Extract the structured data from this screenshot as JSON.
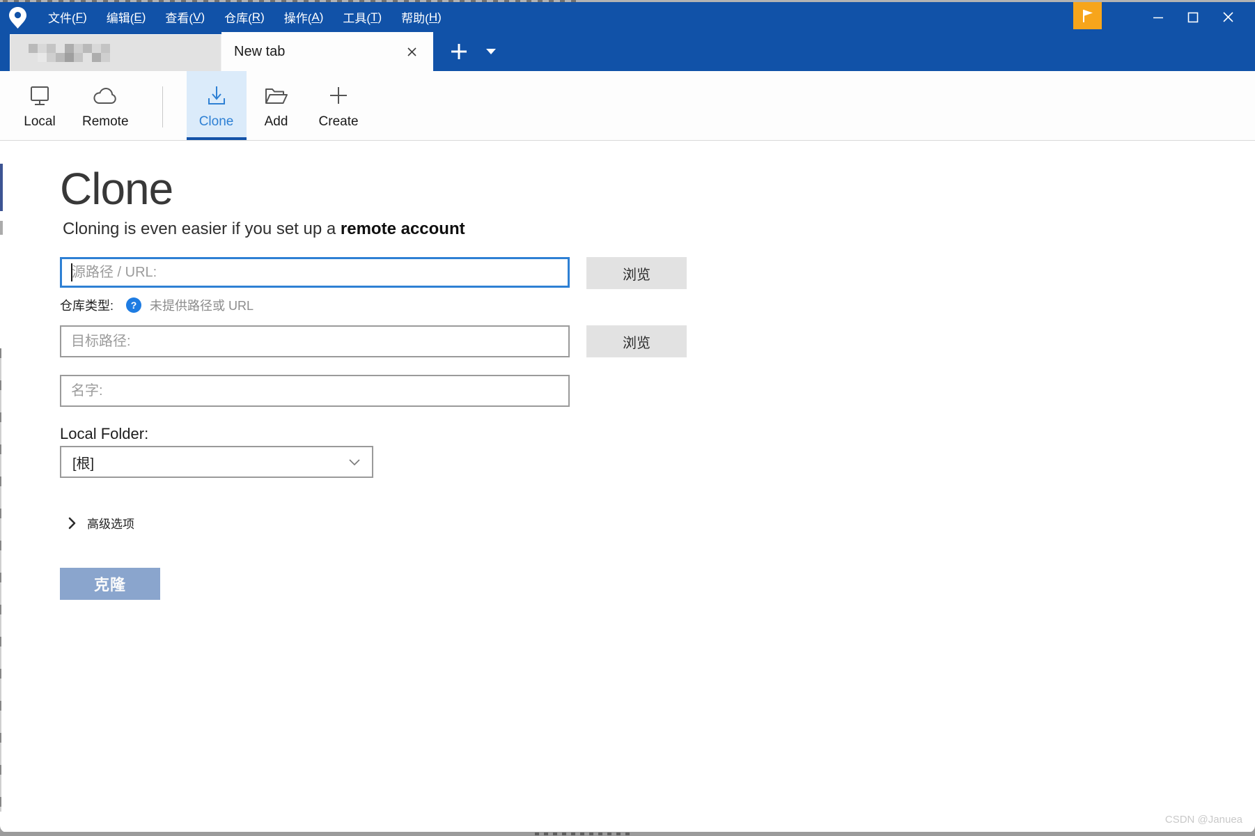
{
  "titlebar": {
    "menu": {
      "items": [
        {
          "pre": "文件(",
          "key": "F",
          "post": ")"
        },
        {
          "pre": "编辑(",
          "key": "E",
          "post": ")"
        },
        {
          "pre": "查看(",
          "key": "V",
          "post": ")"
        },
        {
          "pre": "仓库(",
          "key": "R",
          "post": ")"
        },
        {
          "pre": "操作(",
          "key": "A",
          "post": ")"
        },
        {
          "pre": "工具(",
          "key": "T",
          "post": ")"
        },
        {
          "pre": "帮助(",
          "key": "H",
          "post": ")"
        }
      ]
    },
    "flag_button_icon": "flag-icon",
    "window_controls": {
      "minimize": "minimize-icon",
      "maximize": "maximize-icon",
      "close": "close-icon"
    }
  },
  "tabs": {
    "redacted_tab_note": "pixelated-redacted-repo-name",
    "new_tab": {
      "label": "New tab",
      "close_icon": "close-icon"
    },
    "add_tab_icon": "plus-icon",
    "tab_list_icon": "chevron-down-icon"
  },
  "toolbar": {
    "items": [
      {
        "label": "Local",
        "icon": "monitor-icon"
      },
      {
        "label": "Remote",
        "icon": "cloud-icon"
      },
      {
        "label": "Clone",
        "icon": "download-icon",
        "active": true
      },
      {
        "label": "Add",
        "icon": "open-folder-icon"
      },
      {
        "label": "Create",
        "icon": "plus-icon"
      }
    ]
  },
  "clone_page": {
    "title": "Clone",
    "subtitle_prefix": "Cloning is even easier if you set up a ",
    "subtitle_link": "remote account",
    "source_input": {
      "placeholder": "源路径 / URL:",
      "value": ""
    },
    "browse_source_button": "浏览",
    "repo_type": {
      "label": "仓库类型:",
      "help_glyph": "?",
      "status": "未提供路径或 URL"
    },
    "dest_input": {
      "placeholder": "目标路径:",
      "value": ""
    },
    "browse_dest_button": "浏览",
    "name_input": {
      "placeholder": "名字:",
      "value": ""
    },
    "local_folder": {
      "label": "Local Folder:",
      "selected": "[根]"
    },
    "advanced_options_label": "高级选项",
    "clone_button_label": "克隆"
  },
  "watermark": "CSDN @Januea",
  "colors": {
    "titlebar_blue": "#1152A8",
    "flag_orange": "#F7A51B",
    "accent_blue": "#2E80D4",
    "active_tab_underline": "#1353A8",
    "active_tool_bg": "#DBEBFA",
    "help_icon_blue": "#1E7CE2",
    "disabled_clone_button": "#8AA5CD",
    "focused_input_border": "#2E80D4",
    "input_border": "#9A9A9A"
  }
}
